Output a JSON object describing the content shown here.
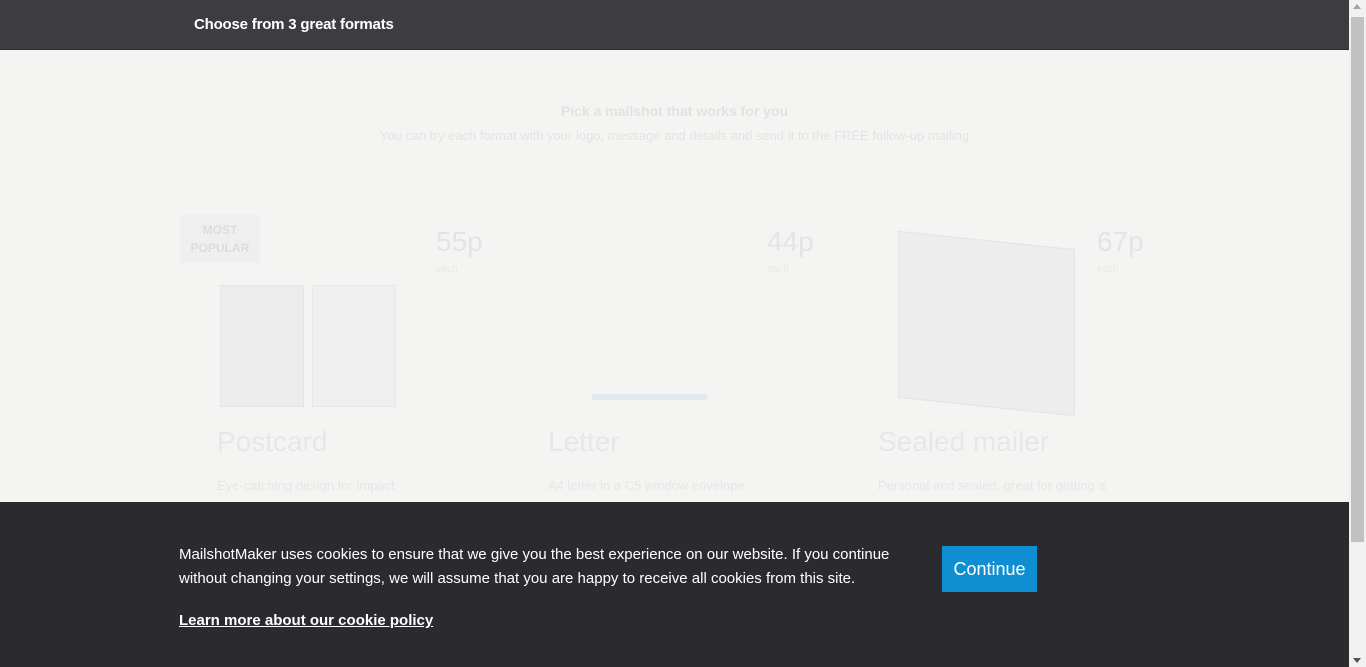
{
  "header": {
    "title": "Choose from 3 great formats"
  },
  "intro": {
    "heading": "Pick a mailshot that works for you",
    "text_before": "You can try each format with your logo, message and details and send it to the",
    "text_highlight": "FREE",
    "text_after": "follow-up mailing"
  },
  "formats": [
    {
      "badge": "MOST POPULAR",
      "price": "55p",
      "price_note": "each",
      "title": "Postcard",
      "desc": "Eye-catching design for impact"
    },
    {
      "price": "44p",
      "price_note": "each",
      "title": "Letter",
      "desc": "A4 letter in a C5 window envelope"
    },
    {
      "price": "67p",
      "price_note": "each",
      "title": "Sealed mailer",
      "desc": "Personal and sealed, great for getting a"
    }
  ],
  "cookie": {
    "message": "MailshotMaker uses cookies to ensure that we give you the best experience on our website. If you continue without changing your settings, we will assume that you are happy to receive all cookies from this site.",
    "link": "Learn more about our cookie policy",
    "button": "Continue"
  },
  "colors": {
    "header_bg": "#3d3c40",
    "banner_bg": "#2b2a2f",
    "accent": "#0f8fd1"
  }
}
